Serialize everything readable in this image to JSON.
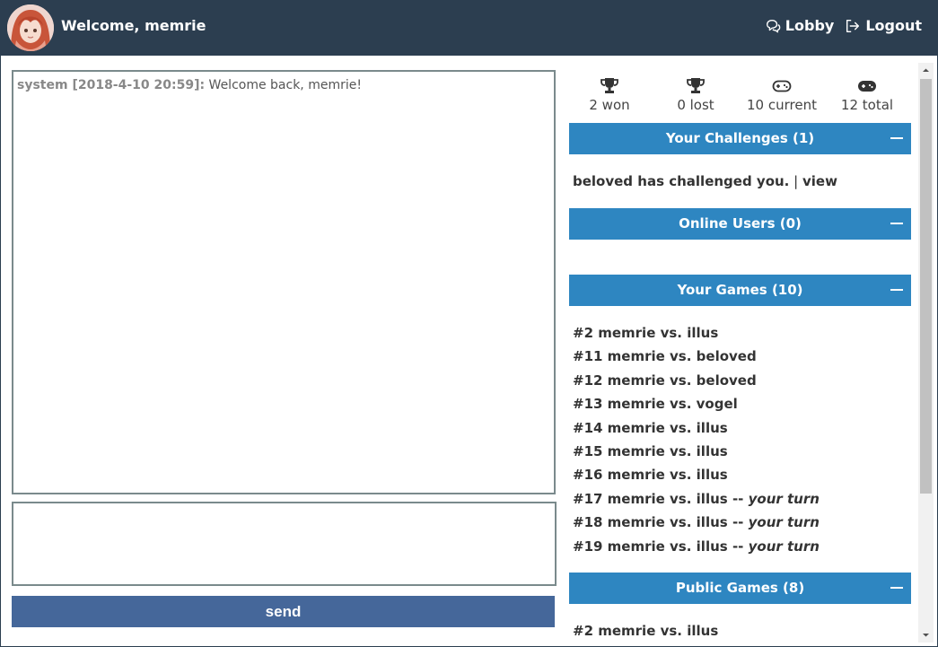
{
  "header": {
    "welcome": "Welcome, memrie",
    "lobby_label": "Lobby",
    "logout_label": "Logout"
  },
  "chat": {
    "messages": [
      {
        "sender": "system [2018-4-10 20:59]:",
        "text": " Welcome back, memrie!"
      }
    ],
    "input_value": "",
    "send_label": "send"
  },
  "stats": [
    {
      "icon": "trophy-icon",
      "label": "2 won"
    },
    {
      "icon": "trophy-icon",
      "label": "0 lost"
    },
    {
      "icon": "gamepad-outline-icon",
      "label": "10 current"
    },
    {
      "icon": "gamepad-icon",
      "label": "12 total"
    }
  ],
  "sections": {
    "challenges": {
      "title": "Your Challenges (1)",
      "items": [
        {
          "text": "beloved has challenged you.",
          "separator": " | ",
          "action": "view"
        }
      ]
    },
    "online": {
      "title": "Online Users (0)",
      "items": []
    },
    "your_games": {
      "title": "Your Games (10)",
      "items": [
        {
          "text": "#2 memrie vs. illus",
          "turn": ""
        },
        {
          "text": "#11 memrie vs. beloved",
          "turn": ""
        },
        {
          "text": "#12 memrie vs. beloved",
          "turn": ""
        },
        {
          "text": "#13 memrie vs. vogel",
          "turn": ""
        },
        {
          "text": "#14 memrie vs. illus",
          "turn": ""
        },
        {
          "text": "#15 memrie vs. illus",
          "turn": ""
        },
        {
          "text": "#16 memrie vs. illus",
          "turn": ""
        },
        {
          "text": "#17 memrie vs. illus",
          "turn": "your turn"
        },
        {
          "text": "#18 memrie vs. illus",
          "turn": "your turn"
        },
        {
          "text": "#19 memrie vs. illus",
          "turn": "your turn"
        }
      ]
    },
    "public_games": {
      "title": "Public Games (8)",
      "items": [
        {
          "text": "#2 memrie vs. illus"
        }
      ]
    }
  },
  "turn_prefix": "-- ",
  "colors": {
    "header_bg": "#2c3e50",
    "section_bg": "#2e86c1",
    "send_bg": "#45679a"
  }
}
